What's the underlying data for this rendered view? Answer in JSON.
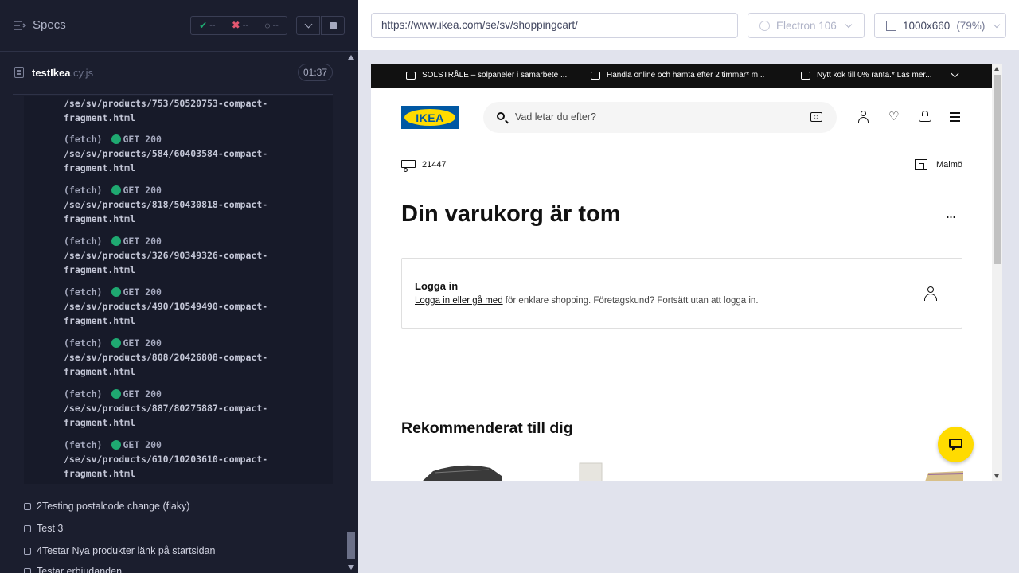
{
  "reporter": {
    "header": {
      "specs_label": "Specs",
      "passed": "--",
      "failed": "--",
      "pending": "--"
    },
    "spec": {
      "name": "testIkea",
      "ext": ".cy.js",
      "duration": "01:37"
    },
    "log": [
      {
        "fetch": "",
        "method": "",
        "path": "/se/sv/products/753/50520753-compact-",
        "tail": "fragment.html"
      },
      {
        "fetch": "(fetch)",
        "method": "GET 200",
        "path": "/se/sv/products/584/60403584-compact-",
        "tail": "fragment.html"
      },
      {
        "fetch": "(fetch)",
        "method": "GET 200",
        "path": "/se/sv/products/818/50430818-compact-",
        "tail": "fragment.html"
      },
      {
        "fetch": "(fetch)",
        "method": "GET 200",
        "path": "/se/sv/products/326/90349326-compact-",
        "tail": "fragment.html"
      },
      {
        "fetch": "(fetch)",
        "method": "GET 200",
        "path": "/se/sv/products/490/10549490-compact-",
        "tail": "fragment.html"
      },
      {
        "fetch": "(fetch)",
        "method": "GET 200",
        "path": "/se/sv/products/808/20426808-compact-",
        "tail": "fragment.html"
      },
      {
        "fetch": "(fetch)",
        "method": "GET 200",
        "path": "/se/sv/products/887/80275887-compact-",
        "tail": "fragment.html"
      },
      {
        "fetch": "(fetch)",
        "method": "GET 200",
        "path": "/se/sv/products/610/10203610-compact-",
        "tail": "fragment.html"
      }
    ],
    "tests": [
      "2Testing postalcode change (flaky)",
      "Test 3",
      "4Testar Nya produkter länk på startsidan",
      "Testar erbjudanden"
    ]
  },
  "topbar": {
    "url": "https://www.ikea.com/se/sv/shoppingcart/",
    "browser": "Electron 106",
    "viewport": "1000x660",
    "zoom": "(79%)"
  },
  "page": {
    "promos": [
      "SOLSTRÅLE – solpaneler i samarbete ...",
      "Handla online och hämta efter 2 timmar* m...",
      "Nytt kök till 0% ränta.* Läs mer..."
    ],
    "logo_text": "IKEA",
    "search_placeholder": "Vad letar du efter?",
    "postal_code": "21447",
    "store": "Malmö",
    "cart_title": "Din varukorg är tom",
    "more_label": "...",
    "login": {
      "title": "Logga in",
      "link": "Logga in eller gå med",
      "text": " för enklare shopping. Företagskund? Fortsätt utan att logga in."
    },
    "recommend_title": "Rekommenderat till dig"
  },
  "colors": {
    "reporter_bg": "#1b1e2e",
    "passed": "#1fa971",
    "failed": "#e45770",
    "ikea_blue": "#0058a3",
    "ikea_yellow": "#ffdb00"
  }
}
